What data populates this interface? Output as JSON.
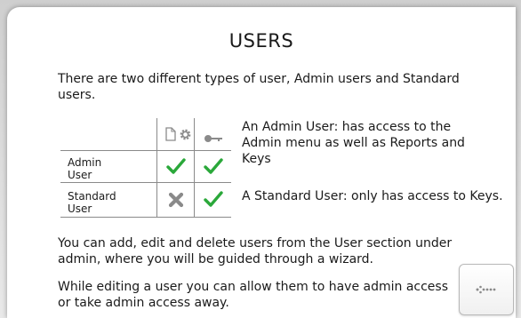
{
  "page": {
    "title": "USERS",
    "intro": "There are two different types of user, Admin users and Standard users."
  },
  "table": {
    "columns": [
      {
        "icons": [
          "document-icon",
          "gear-icon"
        ]
      },
      {
        "icons": [
          "key-icon"
        ]
      }
    ],
    "rows": [
      {
        "label": "Admin User",
        "admin_access": true,
        "keys_access": true
      },
      {
        "label": "Standard User",
        "admin_access": false,
        "keys_access": true
      }
    ]
  },
  "descriptions": {
    "admin": "An Admin User:   has access to the Admin menu as well as Reports and Keys",
    "standard": "A Standard User:   only has access to Keys."
  },
  "paragraphs": {
    "manage": "You can add, edit and delete users from the User section under admin, where you will be guided through a wizard.",
    "editing": "While editing a user you can allow them to have admin access or take admin access away."
  },
  "nav": {
    "back_icon": "arrow-left-dotted-icon"
  },
  "colors": {
    "check": "#2aa83a",
    "cross": "#8a8a8a"
  }
}
